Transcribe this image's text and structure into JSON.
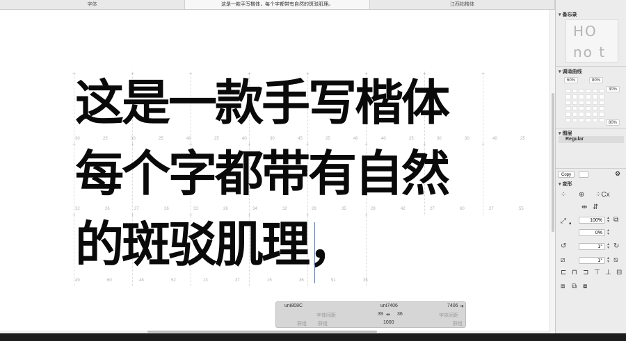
{
  "tabs": [
    {
      "label": "字体",
      "active": false
    },
    {
      "label": "这是一款手写楷体，每个字都带有自然的斑驳肌理。",
      "active": true
    },
    {
      "label": "江西拙楷体",
      "active": false
    }
  ],
  "canvas": {
    "lines": [
      "这是一款手写楷体",
      "每个字都带有自然",
      "的斑驳肌理，"
    ],
    "metrics_row1": [
      "30",
      "25",
      "30",
      "25",
      "40",
      "25",
      "40",
      "30",
      "45",
      "25",
      "40",
      "40",
      "25",
      "30",
      "30",
      "40",
      "25"
    ],
    "metrics_row2": [
      "32",
      "26",
      "27",
      "26",
      "33",
      "26",
      "34",
      "32",
      "28",
      "35",
      "28",
      "42",
      "27",
      "60",
      "27",
      "55"
    ],
    "metrics_row3": [
      "49",
      "60",
      "48",
      "52",
      "13",
      "37",
      "15",
      "36",
      "91",
      "35"
    ]
  },
  "infobar": {
    "glyph_left": "uni808C",
    "glyph_center": "uni7406",
    "glyph_code": "7406",
    "left_label": "字体间距",
    "right_label": "字体间距",
    "lsb": "39",
    "rsb": "36",
    "group_left_1": "群组",
    "group_left_2": "群组",
    "width_value": "1000",
    "group_right": "群组"
  },
  "sidebar": {
    "preview_title": "备忘录",
    "preview_top": "HO",
    "preview_bottom": "no  t",
    "kerning_title": "调适曲线",
    "pct_60": "60%",
    "pct_80a": "80%",
    "pct_30": "30%",
    "pct_80b": "80%",
    "layers_title": "图层",
    "layer_name": "Regular",
    "copy_label": "Copy",
    "transform_title": "变形",
    "scale_value": "100%",
    "offset_value": "0%",
    "rotate_value": "1°",
    "slant_value": "1°"
  }
}
